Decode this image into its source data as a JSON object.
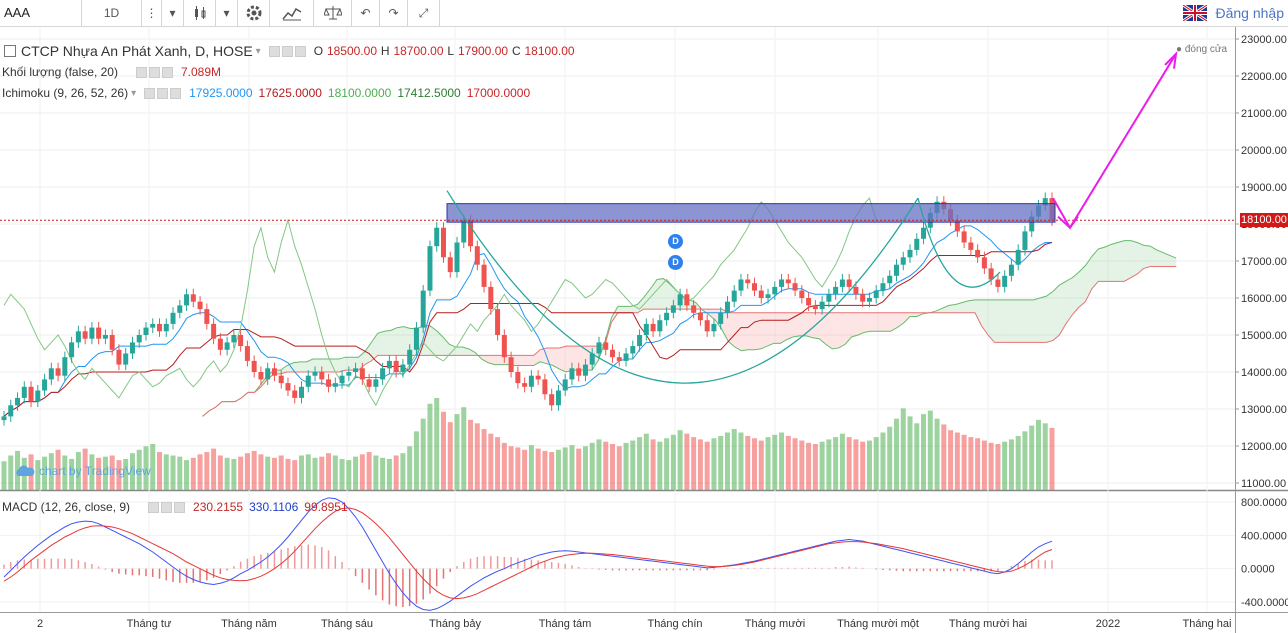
{
  "toolbar": {
    "symbol": "AAA",
    "interval": "1D",
    "login_label": "Đăng nhập"
  },
  "legend": {
    "main_title": "CTCP Nhựa An Phát Xanh, D, HOSE",
    "o_label": "O",
    "o_val": "18500.00",
    "h_label": "H",
    "h_val": "18700.00",
    "l_label": "L",
    "l_val": "17900.00",
    "c_label": "C",
    "c_val": "18100.00",
    "volume_title": "Khối lượng (false, 20)",
    "volume_val": "7.089M",
    "ichimoku_title": "Ichimoku (9, 26, 52, 26)",
    "ichi_vals": [
      "17925.0000",
      "17625.0000",
      "18100.0000",
      "17412.5000",
      "17000.0000"
    ],
    "macd_title": "MACD (12, 26, close, 9)",
    "macd_vals": [
      "230.2155",
      "330.1106",
      "99.8951"
    ]
  },
  "colors": {
    "up": "#26a69a",
    "down": "#ef5350",
    "tenkan": "#2196f3",
    "kijun": "#b71c1c",
    "chikou": "#4caf50",
    "arrow": "#e91ee9",
    "zone": "#6672c2"
  },
  "price_axis": [
    "23000.00",
    "22000.00",
    "21000.00",
    "20000.00",
    "19000.00",
    "18000.00",
    "17000.00",
    "16000.00",
    "15000.00",
    "14000.00",
    "13000.00",
    "12000.00",
    "11000.00"
  ],
  "current_price": "18100.00",
  "dong_cua": "đóng cửa",
  "macd_axis": [
    "800.0000",
    "400.0000",
    "0.0000",
    "-400.0000"
  ],
  "time_axis": [
    "2",
    "Tháng tư",
    "Tháng năm",
    "Tháng sáu",
    "Tháng bảy",
    "Tháng tám",
    "Tháng chín",
    "Tháng mười",
    "Tháng mười một",
    "Tháng mười hai",
    "2022",
    "Tháng hai"
  ],
  "watermark": "chart by TradingView",
  "markers": [
    "D",
    "D"
  ],
  "chart_data": {
    "type": "candlestick",
    "ylim": [
      11000,
      23000
    ],
    "macd_ylim": [
      -400,
      800
    ],
    "closes": [
      12800,
      13100,
      13300,
      13600,
      13200,
      13500,
      13800,
      14100,
      13900,
      14400,
      14800,
      15100,
      14900,
      15200,
      14900,
      15000,
      14600,
      14200,
      14500,
      14800,
      15000,
      15200,
      15300,
      15100,
      15300,
      15600,
      15800,
      16100,
      15900,
      15700,
      15300,
      14900,
      14600,
      14800,
      15000,
      14700,
      14300,
      14000,
      13800,
      14100,
      13900,
      13700,
      13500,
      13300,
      13600,
      13900,
      14000,
      13800,
      13600,
      13700,
      13900,
      14000,
      14100,
      13800,
      13600,
      13800,
      14100,
      14300,
      14000,
      14200,
      14600,
      15200,
      16200,
      17400,
      17900,
      17100,
      16700,
      17500,
      18100,
      17400,
      16900,
      16300,
      15700,
      15000,
      14400,
      14000,
      13700,
      13600,
      13900,
      13800,
      13400,
      13100,
      13500,
      13800,
      14100,
      13900,
      14200,
      14500,
      14800,
      14600,
      14400,
      14300,
      14500,
      14700,
      15000,
      15300,
      15100,
      15400,
      15600,
      15800,
      16100,
      15800,
      15600,
      15400,
      15100,
      15300,
      15600,
      15900,
      16200,
      16500,
      16400,
      16200,
      16000,
      16100,
      16300,
      16500,
      16400,
      16200,
      16000,
      15800,
      15700,
      15900,
      16100,
      16300,
      16500,
      16300,
      16100,
      15900,
      16000,
      16200,
      16400,
      16600,
      16900,
      17100,
      17300,
      17600,
      17900,
      18300,
      18600,
      18400,
      18100,
      17800,
      17500,
      17300,
      17100,
      16800,
      16500,
      16300,
      16600,
      16900,
      17300,
      17800,
      18200,
      18500,
      18700,
      18100
    ],
    "volumes": [
      2.5,
      3.0,
      3.4,
      2.8,
      3.1,
      2.6,
      2.9,
      3.2,
      3.5,
      3.0,
      2.7,
      3.3,
      3.6,
      3.1,
      2.8,
      2.9,
      3.0,
      2.6,
      2.7,
      3.2,
      3.5,
      3.8,
      4.0,
      3.3,
      3.1,
      3.0,
      2.9,
      2.6,
      2.8,
      3.1,
      3.3,
      3.6,
      3.0,
      2.8,
      2.7,
      2.9,
      3.2,
      3.4,
      3.1,
      2.9,
      2.8,
      3.0,
      2.7,
      2.6,
      3.0,
      3.1,
      2.8,
      2.9,
      3.2,
      3.0,
      2.7,
      2.6,
      2.9,
      3.1,
      3.3,
      3.0,
      2.8,
      2.7,
      3.0,
      3.2,
      3.8,
      5.1,
      6.2,
      7.5,
      8.0,
      6.8,
      5.9,
      6.6,
      7.2,
      6.1,
      5.8,
      5.3,
      4.9,
      4.6,
      4.1,
      3.8,
      3.7,
      3.5,
      3.9,
      3.6,
      3.4,
      3.3,
      3.5,
      3.7,
      3.9,
      3.6,
      3.8,
      4.1,
      4.4,
      4.2,
      4.0,
      3.8,
      4.1,
      4.3,
      4.6,
      4.9,
      4.4,
      4.2,
      4.5,
      4.8,
      5.2,
      4.9,
      4.6,
      4.4,
      4.2,
      4.5,
      4.7,
      5.0,
      5.3,
      5.0,
      4.7,
      4.5,
      4.3,
      4.6,
      4.8,
      5.0,
      4.7,
      4.5,
      4.3,
      4.1,
      4.0,
      4.2,
      4.4,
      4.6,
      4.9,
      4.6,
      4.4,
      4.2,
      4.3,
      4.6,
      5.0,
      5.5,
      6.2,
      7.1,
      6.4,
      5.8,
      6.6,
      6.9,
      6.2,
      5.7,
      5.2,
      5.0,
      4.8,
      4.6,
      4.5,
      4.3,
      4.1,
      4.0,
      4.2,
      4.4,
      4.7,
      5.1,
      5.6,
      6.1,
      5.8,
      5.4
    ],
    "macd": [
      -100,
      -20,
      60,
      140,
      210,
      280,
      340,
      400,
      450,
      500,
      540,
      560,
      570,
      565,
      540,
      500,
      460,
      420,
      380,
      340,
      300,
      250,
      200,
      140,
      80,
      20,
      -40,
      -90,
      -130,
      -160,
      -180,
      -190,
      -175,
      -150,
      -110,
      -60,
      -20,
      30,
      80,
      140,
      210,
      290,
      380,
      480,
      580,
      680,
      760,
      820,
      850,
      840,
      800,
      720,
      620,
      500,
      360,
      220,
      80,
      -60,
      -180,
      -290,
      -380,
      -450,
      -490,
      -500,
      -480,
      -440,
      -390,
      -330,
      -270,
      -210,
      -160,
      -110,
      -70,
      -30,
      0,
      40,
      70,
      100,
      130,
      160,
      180,
      200,
      210,
      215,
      210,
      200,
      190,
      180,
      170,
      160,
      150,
      140,
      130,
      120,
      110,
      100,
      90,
      80,
      70,
      60,
      50,
      40,
      30,
      20,
      10,
      15,
      25,
      35,
      45,
      60,
      75,
      90,
      110,
      130,
      150,
      170,
      190,
      210,
      230,
      250,
      270,
      290,
      310,
      330,
      340,
      350,
      340,
      330,
      310,
      290,
      270,
      250,
      230,
      210,
      190,
      170,
      150,
      130,
      110,
      90,
      70,
      50,
      30,
      10,
      -10,
      -30,
      -50,
      -60,
      -40,
      0,
      60,
      130,
      200,
      260,
      300,
      330
    ],
    "signal": [
      -150,
      -100,
      -40,
      30,
      100,
      160,
      220,
      280,
      330,
      380,
      420,
      460,
      490,
      510,
      515,
      510,
      500,
      480,
      450,
      420,
      380,
      340,
      300,
      260,
      220,
      180,
      130,
      80,
      40,
      0,
      -40,
      -80,
      -110,
      -130,
      -140,
      -145,
      -140,
      -120,
      -90,
      -50,
      0,
      60,
      130,
      210,
      300,
      390,
      480,
      560,
      630,
      690,
      720,
      730,
      710,
      670,
      610,
      540,
      460,
      370,
      270,
      170,
      70,
      -30,
      -120,
      -200,
      -270,
      -320,
      -350,
      -360,
      -350,
      -330,
      -300,
      -260,
      -220,
      -180,
      -140,
      -100,
      -60,
      -20,
      20,
      60,
      90,
      120,
      140,
      160,
      170,
      180,
      185,
      185,
      180,
      175,
      170,
      160,
      150,
      140,
      130,
      120,
      110,
      100,
      90,
      80,
      70,
      60,
      50,
      40,
      30,
      25,
      25,
      30,
      40,
      50,
      65,
      80,
      100,
      120,
      140,
      160,
      180,
      200,
      220,
      240,
      260,
      280,
      300,
      310,
      320,
      325,
      325,
      320,
      310,
      300,
      285,
      270,
      255,
      240,
      220,
      200,
      180,
      160,
      140,
      120,
      100,
      80,
      60,
      40,
      20,
      0,
      -20,
      -35,
      -40,
      -30,
      0,
      40,
      90,
      150,
      200,
      230
    ]
  }
}
